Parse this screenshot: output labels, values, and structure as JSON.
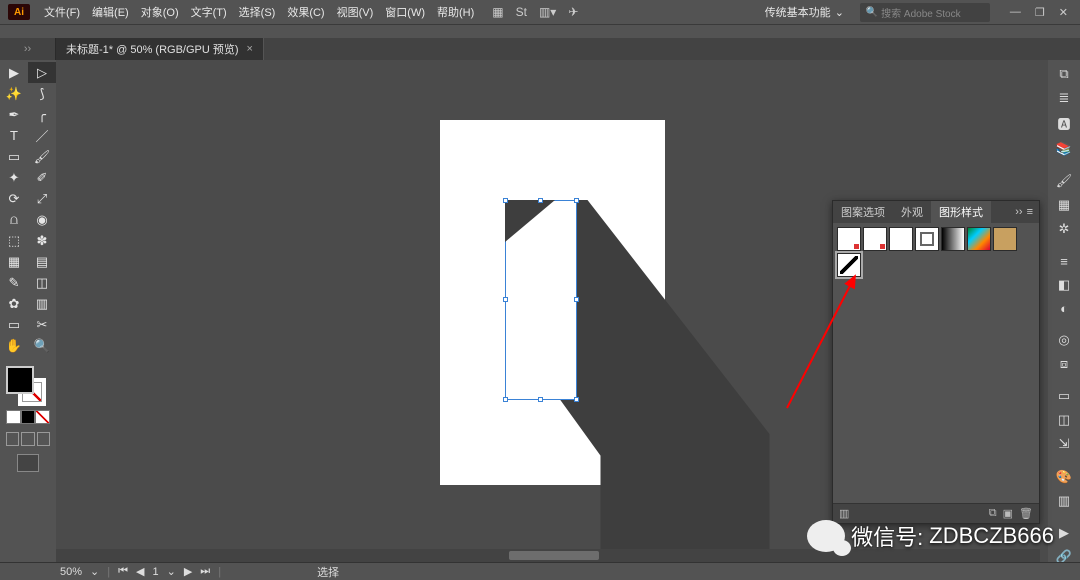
{
  "app": {
    "name": "Ai"
  },
  "menu": {
    "file": "文件(F)",
    "edit": "编辑(E)",
    "object": "对象(O)",
    "type": "文字(T)",
    "select": "选择(S)",
    "effect": "效果(C)",
    "view": "视图(V)",
    "window": "窗口(W)",
    "help": "帮助(H)"
  },
  "workspace": {
    "label": "传统基本功能",
    "caret": "⌄"
  },
  "stock_search": {
    "icon": "🔍",
    "placeholder": "搜索 Adobe Stock"
  },
  "win": {
    "min": "—",
    "max": "❐",
    "close": "✕"
  },
  "doc_tab": {
    "title": "未标题-1* @ 50% (RGB/GPU 预览)",
    "close": "×"
  },
  "tools": {
    "selection": "▶",
    "direct": "▷",
    "magicwand": "✨",
    "lasso": "⟆",
    "pen": "✒",
    "curvature": "╭",
    "type": "T",
    "line": "／",
    "rect": "▭",
    "brush": "🖌",
    "shaper": "✦",
    "eraser": "✐",
    "rotate": "⟳",
    "scale": "⤢",
    "width": "⩍",
    "warp": "◉",
    "freetransform": "⬚",
    "puppet": "✽",
    "mesh": "▦",
    "gradient": "▤",
    "eyedrop": "✎",
    "blend": "◫",
    "symbolspray": "✿",
    "graph": "▥",
    "artboard": "▭",
    "slice": "✂",
    "hand": "✋",
    "zoom": "🔍"
  },
  "gstyles": {
    "tab_image": "图案选项",
    "tab_appearance": "外观",
    "tab_graphic": "图形样式",
    "more": "››",
    "menu": "≡"
  },
  "status": {
    "zoom": "50%",
    "artboard_nav": "1",
    "tool": "选择"
  },
  "right_panel_icons": {
    "properties": "⧉",
    "layers": "≣",
    "ai_type": "🅰",
    "libraries": "📚",
    "brushes": "🖌",
    "swatches": "▦",
    "symbols": "✲",
    "stroke": "≡",
    "gradient": "◧",
    "transparency": "◐",
    "appearance": "◎",
    "graphic_styles": "⧈",
    "align": "▭",
    "pathfinder": "◫",
    "transform": "⇲",
    "color": "🎨",
    "color_guide": "▥",
    "actions": "▶",
    "links": "🔗"
  },
  "watermark": {
    "label": "微信号:",
    "value": "ZDBCZB666"
  }
}
